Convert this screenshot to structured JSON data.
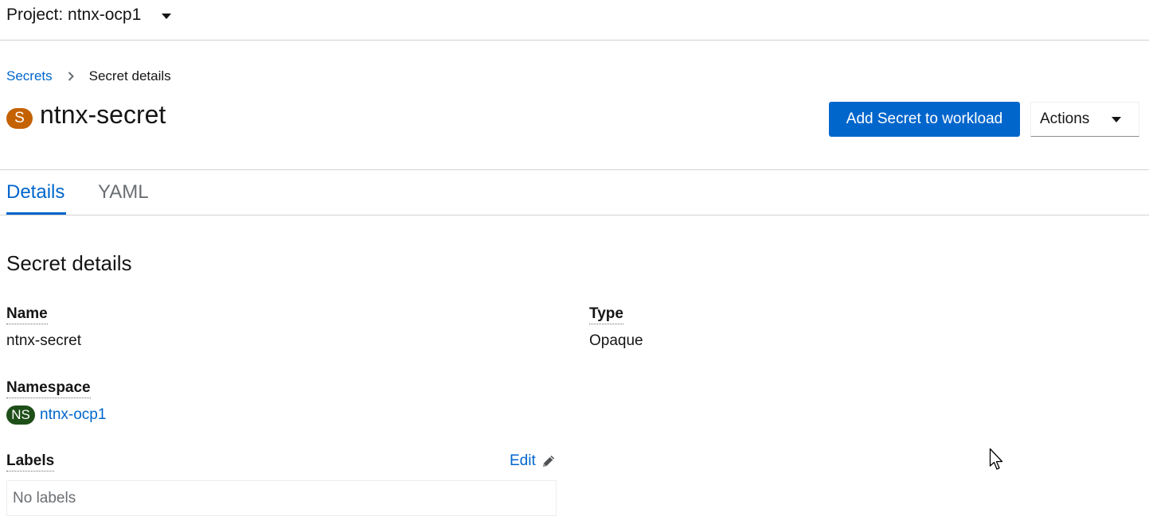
{
  "project": {
    "label": "Project: ntnx-ocp1",
    "icon": "caret-down-icon"
  },
  "breadcrumb": {
    "link": "Secrets",
    "current": "Secret details"
  },
  "header": {
    "badge": "S",
    "badge_color": "#c46100",
    "title": "ntnx-secret",
    "primary_button": "Add Secret to workload",
    "actions_label": "Actions"
  },
  "tabs": [
    {
      "label": "Details",
      "active": true
    },
    {
      "label": "YAML",
      "active": false
    }
  ],
  "details": {
    "section_title": "Secret details",
    "name_label": "Name",
    "name_value": "ntnx-secret",
    "type_label": "Type",
    "type_value": "Opaque",
    "namespace_label": "Namespace",
    "namespace_badge": "NS",
    "namespace_badge_color": "#1e4f18",
    "namespace_value": "ntnx-ocp1",
    "labels_label": "Labels",
    "edit_label": "Edit",
    "labels_empty": "No labels"
  },
  "colors": {
    "accent": "#0066cc"
  }
}
